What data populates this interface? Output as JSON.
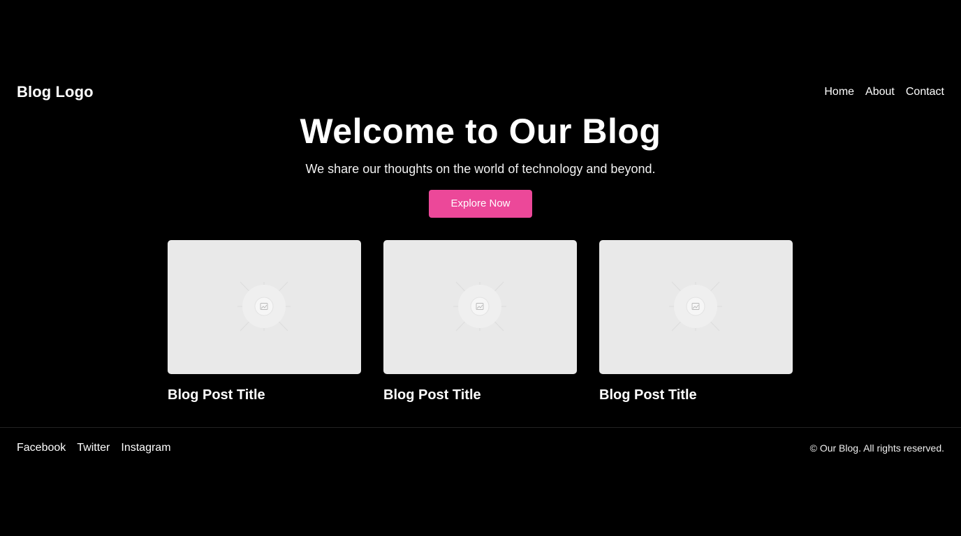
{
  "header": {
    "logo": "Blog Logo",
    "nav": [
      "Home",
      "About",
      "Contact"
    ]
  },
  "hero": {
    "title": "Welcome to Our Blog",
    "subtitle": "We share our thoughts on the world of technology and beyond.",
    "cta_label": "Explore Now"
  },
  "posts": [
    {
      "title": "Blog Post Title",
      "image_icon": "image-placeholder-icon"
    },
    {
      "title": "Blog Post Title",
      "image_icon": "image-placeholder-icon"
    },
    {
      "title": "Blog Post Title",
      "image_icon": "image-placeholder-icon"
    }
  ],
  "footer": {
    "social": [
      "Facebook",
      "Twitter",
      "Instagram"
    ],
    "copyright": "© Our Blog. All rights reserved."
  },
  "colors": {
    "background": "#000000",
    "accent": "#ec4899",
    "placeholder": "#e9e9e9",
    "text": "#ffffff"
  }
}
